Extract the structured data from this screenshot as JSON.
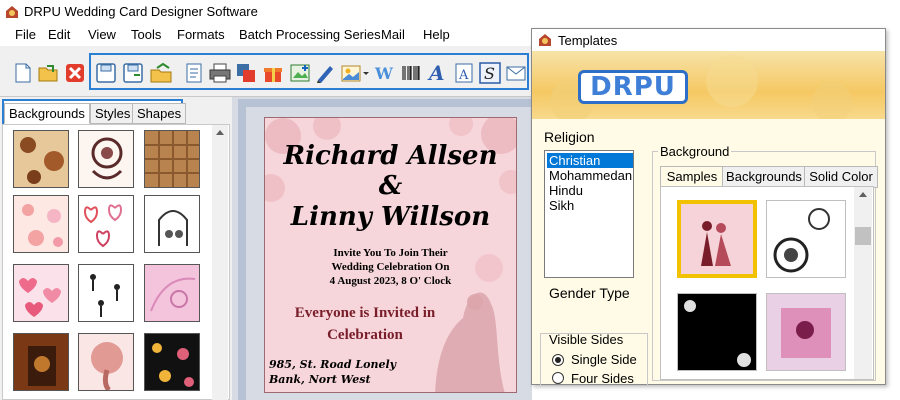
{
  "app": {
    "title": "DRPU Wedding Card Designer Software"
  },
  "menu": [
    "File",
    "Edit",
    "View",
    "Tools",
    "Formats",
    "Batch Processing Series",
    "Mail",
    "Help"
  ],
  "toolbar": {
    "icons": [
      "new-icon",
      "open-icon",
      "close-icon",
      "save-icon",
      "save-as-icon",
      "export-icon",
      "properties-icon",
      "print-icon",
      "copy-design-icon",
      "gift-icon",
      "add-image-icon",
      "pen-icon",
      "picture-icon",
      "wordart-icon",
      "barcode-icon",
      "text-icon",
      "text-box-icon",
      "signature-icon",
      "mail-icon"
    ]
  },
  "left_tabs": [
    "Backgrounds",
    "Styles",
    "Shapes"
  ],
  "card": {
    "names_line1": "Richard Allsen",
    "ampersand": "&",
    "names_line2": "Linny Willson",
    "invite_line1": "Invite You To Join Their",
    "invite_line2": "Wedding Celebration On",
    "date": "4 August 2023, 8 O' Clock",
    "everyone_line1": "Everyone is Invited in",
    "everyone_line2": "Celebration",
    "address_line1": "985, St. Road Lonely",
    "address_line2": "Bank, Nort West"
  },
  "templates": {
    "title": "Templates",
    "logo": "DRPU",
    "religion_label": "Religion",
    "religions": [
      "Christian",
      "Mohammedan",
      "Hindu",
      "Sikh"
    ],
    "selected_religion": "Christian",
    "gender_type_label": "Gender Type",
    "background_label": "Background",
    "tabs": [
      "Samples",
      "Backgrounds",
      "Solid Color"
    ],
    "visible_sides_label": "Visible Sides",
    "sides": [
      "Single Side",
      "Four Sides"
    ],
    "selected_side": "Single Side"
  },
  "colors": {
    "highlight_blue": "#2b7fd3",
    "selection_blue": "#0078d7",
    "card_pink": "#f6d6da",
    "card_text_maroon": "#7a1d2a",
    "selected_sample_border": "#f2c200"
  }
}
